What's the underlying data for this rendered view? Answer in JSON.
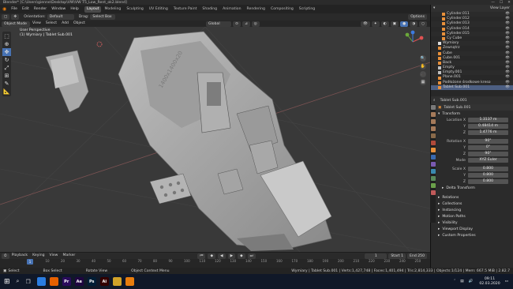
{
  "window": {
    "title": "Blender* [C:\\Users\\gienne\\Desktop\\VW\\VW T5_Low_Rent_ok2.blend]",
    "controls": [
      "—",
      "☐",
      "✕"
    ]
  },
  "menubar": {
    "items": [
      "File",
      "Edit",
      "Render",
      "Window",
      "Help"
    ],
    "workspaces": [
      "Layout",
      "Modeling",
      "Sculpting",
      "UV Editing",
      "Texture Paint",
      "Shading",
      "Animation",
      "Rendering",
      "Compositing",
      "Scripting"
    ],
    "active_workspace": "Layout",
    "scene": "Scene",
    "view_layer": "View Layer"
  },
  "tool_header": {
    "orientation_label": "Orientation:",
    "orientation_value": "Default",
    "drag_label": "Drag:",
    "drag_value": "Select Box",
    "options": "Options"
  },
  "viewport_header": {
    "mode": "Object Mode",
    "menus": [
      "View",
      "Select",
      "Add",
      "Object"
    ],
    "transform": "Global"
  },
  "viewport": {
    "info_line1": "User Perspective",
    "info_line2": "(1) Wymiary | Tablet Sub.001",
    "van_label": "1400x1400x20"
  },
  "toolbar": {
    "tools": [
      "select",
      "cursor",
      "move",
      "rotate",
      "scale",
      "transform",
      "annotate",
      "measure"
    ],
    "active_index": 2
  },
  "outliner": {
    "rows": [
      {
        "name": "Cylinder.011",
        "type": "mesh",
        "indent": 2
      },
      {
        "name": "Cylinder.012",
        "type": "mesh",
        "indent": 2
      },
      {
        "name": "Cylinder.013",
        "type": "mesh",
        "indent": 2
      },
      {
        "name": "Cylinder.014",
        "type": "mesh",
        "indent": 2
      },
      {
        "name": "Cylinder.015",
        "type": "mesh",
        "indent": 2
      },
      {
        "name": "Cy Cube",
        "type": "mesh",
        "indent": 2
      },
      {
        "name": "Wymiary",
        "type": "collection",
        "indent": 1
      },
      {
        "name": "Zewnątrz",
        "type": "mesh",
        "indent": 1
      },
      {
        "name": "Cube",
        "type": "mesh",
        "indent": 1
      },
      {
        "name": "Cube.001",
        "type": "mesh",
        "indent": 1
      },
      {
        "name": "Back",
        "type": "mesh",
        "indent": 1
      },
      {
        "name": "Empty",
        "type": "empty",
        "indent": 1
      },
      {
        "name": "Empty.001",
        "type": "empty",
        "indent": 1
      },
      {
        "name": "Plane.001",
        "type": "mesh",
        "indent": 1
      },
      {
        "name": "Podłożone środkowe kreso",
        "type": "mesh",
        "indent": 1
      },
      {
        "name": "Tablet Sub.001",
        "type": "mesh",
        "indent": 1,
        "selected": true
      }
    ]
  },
  "properties": {
    "object_name": "Tablet Sub.001",
    "transform_title": "Transform",
    "location_label": "Location X",
    "location": [
      "1.3137 m",
      "0.48414 m",
      "1.4776 m"
    ],
    "rotation_label": "Rotation X",
    "rotation": [
      "90°",
      "0°",
      "90°"
    ],
    "mode_label": "Mode",
    "mode_value": "XYZ Euler",
    "scale_label": "Scale X",
    "scale": [
      "0.800",
      "0.800",
      "0.800"
    ],
    "delta": "Delta Transform",
    "panels": [
      "Relations",
      "Collections",
      "Instancing",
      "Motion Paths",
      "Visibility",
      "Viewport Display",
      "Custom Properties"
    ]
  },
  "timeline": {
    "menus": [
      "Playback",
      "Keying",
      "View",
      "Marker"
    ],
    "frame_current": "1",
    "start_label": "Start",
    "start": "1",
    "end_label": "End",
    "end": "250",
    "ticks": [
      "10",
      "20",
      "30",
      "40",
      "50",
      "60",
      "70",
      "80",
      "90",
      "100",
      "110",
      "120",
      "130",
      "140",
      "150",
      "160",
      "170",
      "180",
      "190",
      "200",
      "210",
      "220",
      "230",
      "240",
      "250"
    ]
  },
  "statusbar": {
    "left": "Select",
    "middle1": "Box Select",
    "middle2": "Rotate View",
    "middle3": "Object Context Menu",
    "stats": "Wymiary | Tablet Sub.001 | Verts:1,427,748 | Faces:1,401,494 | Tris:2,814,333 | Objects:1/124 | Mem: 667.5 MiB | 2.82.7"
  },
  "taskbar": {
    "search_placeholder": "",
    "apps": [
      {
        "name": "chrome",
        "color": "#2a7ce0",
        "label": ""
      },
      {
        "name": "firefox",
        "color": "#e66000",
        "label": ""
      },
      {
        "name": "premiere",
        "color": "#2a0b5c",
        "label": "Pr"
      },
      {
        "name": "aftereffects",
        "color": "#1f0540",
        "label": "Ae"
      },
      {
        "name": "photoshop",
        "color": "#001e36",
        "label": "Ps"
      },
      {
        "name": "illustrator",
        "color": "#330000",
        "label": "Ai"
      },
      {
        "name": "explorer",
        "color": "#d1a229",
        "label": ""
      },
      {
        "name": "blender",
        "color": "#e87d0d",
        "label": ""
      }
    ],
    "time": "09:11",
    "date": "02.03.2020"
  },
  "colors": {
    "accent": "#4772b3",
    "outliner_select": "#4d5f82",
    "blender_orange": "#e87d0d"
  }
}
